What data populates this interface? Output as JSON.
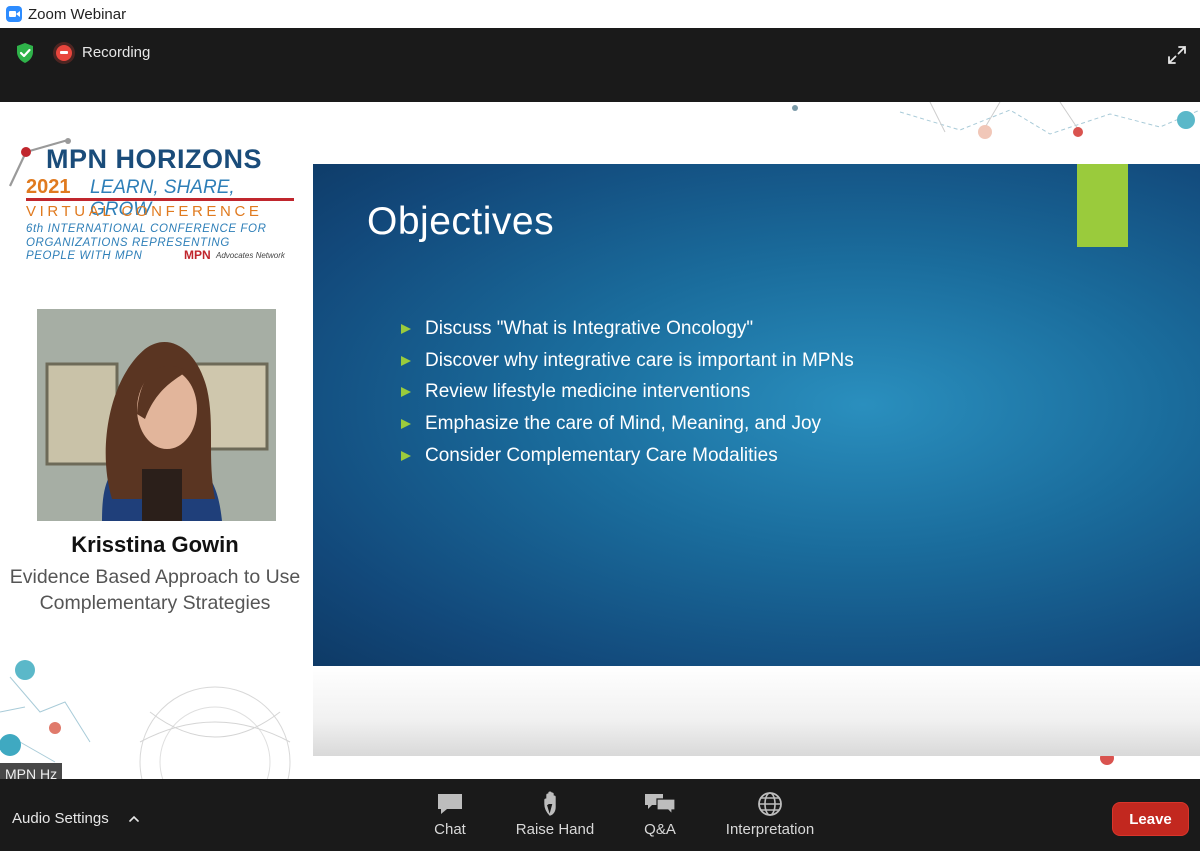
{
  "window": {
    "title": "Zoom Webinar"
  },
  "topbar": {
    "security_icon": "shield-check-icon",
    "recording_label": "Recording",
    "fullscreen_icon": "expand-arrows-icon"
  },
  "conference_logo": {
    "line1": "MPN HORIZONS",
    "year": "2021",
    "tagline": "LEARN, SHARE, GROW",
    "line3": "VIRTUAL CONFERENCE",
    "line4": "6th INTERNATIONAL CONFERENCE FOR ORGANIZATIONS REPRESENTING",
    "line5": "PEOPLE WITH MPN",
    "network_brand": "MPN",
    "network_sub": "Advocates Network"
  },
  "speaker": {
    "name": "Krisstina Gowin",
    "topic": "Evidence Based Approach to Use Complementary Strategies"
  },
  "slide": {
    "title": "Objectives",
    "objectives": [
      "Discuss \"What is Integrative Oncology\"",
      "Discover why integrative care is important in MPNs",
      "Review lifestyle medicine interventions",
      "Emphasize the care of Mind, Meaning, and Joy",
      "Consider Complementary Care Modalities"
    ],
    "accent_color": "#9acb3c"
  },
  "participant_label": "MPN Hz",
  "controls": {
    "audio_settings": "Audio Settings",
    "chat": "Chat",
    "raise_hand": "Raise Hand",
    "qa": "Q&A",
    "interpretation": "Interpretation",
    "leave": "Leave",
    "leave_color": "#c2281f"
  }
}
